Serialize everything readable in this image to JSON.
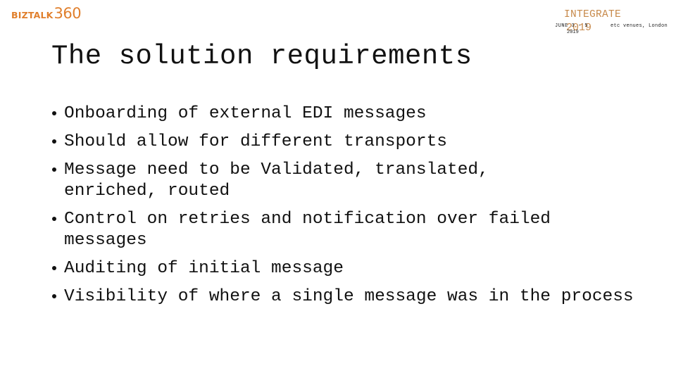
{
  "header": {
    "logo": {
      "brand": "BIZTALK",
      "number": "360",
      "color": "#e07f2c"
    },
    "event": {
      "name": "INTEGRATE",
      "year": "2019",
      "dates": "JUNE 3 - 5",
      "dates_year": "2019",
      "venue": "etc venues, London",
      "accent_color": "#c7894a"
    }
  },
  "slide": {
    "title": "The solution requirements",
    "bullets": [
      "Onboarding of external EDI messages",
      "Should allow for different transports",
      "Message need to be Validated, translated, enriched, routed",
      "Control on retries and notification over failed messages",
      "Auditing of initial message",
      "Visibility of where a single message was in the process"
    ]
  }
}
